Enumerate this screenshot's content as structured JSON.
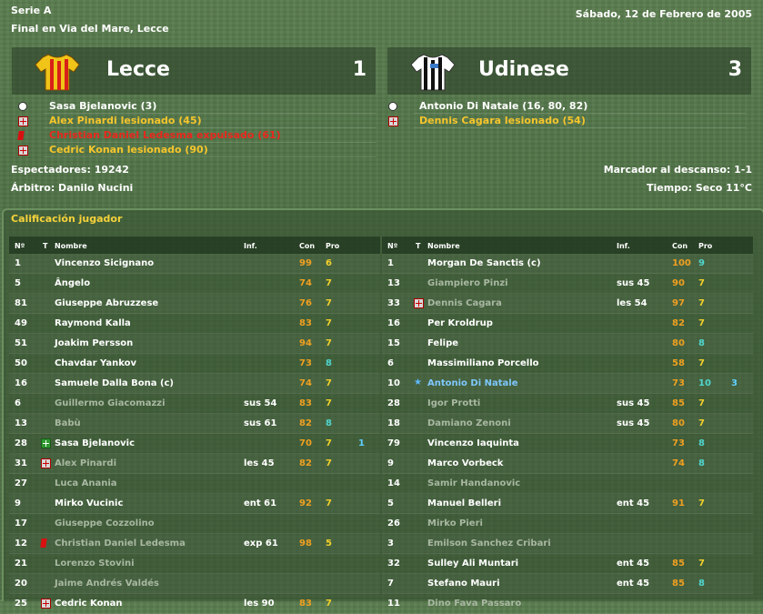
{
  "header": {
    "competition": "Serie A",
    "status": "Final en Via del Mare, Lecce",
    "date": "Sábado, 12 de Febrero de 2005"
  },
  "home": {
    "name": "Lecce",
    "score": "1",
    "shirt_colors": [
      "#f0c418",
      "#d82018"
    ],
    "events": [
      {
        "icon": "ball",
        "text": "Sasa Bjelanovic (3)",
        "color": "#ffffff"
      },
      {
        "icon": "injury",
        "text": "Alex Pinardi lesionado (45)",
        "color": "#f6c52c"
      },
      {
        "icon": "red-card",
        "text": "Christian Daniel Ledesma expulsado (61)",
        "color": "#e8281c"
      },
      {
        "icon": "injury",
        "text": "Cedric Konan lesionado (90)",
        "color": "#f6c52c"
      }
    ]
  },
  "away": {
    "name": "Udinese",
    "score": "3",
    "shirt_colors": [
      "#ffffff",
      "#111111"
    ],
    "events": [
      {
        "icon": "ball",
        "text": "Antonio Di Natale (16, 80, 82)",
        "color": "#ffffff"
      },
      {
        "icon": "injury",
        "text": "Dennis Cagara lesionado (54)",
        "color": "#f6c52c"
      }
    ]
  },
  "info": {
    "spectators": "Espectadores: 19242",
    "referee": "Árbitro: Danilo Nucini",
    "halftime": "Marcador al descanso: 1-1",
    "weather": "Tiempo: Seco 11°C"
  },
  "ratings": {
    "title": "Calificación jugador",
    "columns": {
      "num": "Nº",
      "t": "T",
      "name": "Nombre",
      "inf": "Inf.",
      "con": "Con",
      "pro": "Pro"
    },
    "home_players": [
      {
        "num": "1",
        "icon": "",
        "name": "Vincenzo Sicignano",
        "inf": "",
        "con": "99",
        "pro": "6",
        "goals": "",
        "dim": false,
        "hi": false
      },
      {
        "num": "5",
        "icon": "",
        "name": "Ângelo",
        "inf": "",
        "con": "74",
        "pro": "7",
        "goals": "",
        "dim": false,
        "hi": false
      },
      {
        "num": "81",
        "icon": "",
        "name": "Giuseppe Abruzzese",
        "inf": "",
        "con": "76",
        "pro": "7",
        "goals": "",
        "dim": false,
        "hi": false
      },
      {
        "num": "49",
        "icon": "",
        "name": "Raymond Kalla",
        "inf": "",
        "con": "83",
        "pro": "7",
        "goals": "",
        "dim": false,
        "hi": false
      },
      {
        "num": "51",
        "icon": "",
        "name": "Joakim Persson",
        "inf": "",
        "con": "94",
        "pro": "7",
        "goals": "",
        "dim": false,
        "hi": false
      },
      {
        "num": "50",
        "icon": "",
        "name": "Chavdar Yankov",
        "inf": "",
        "con": "73",
        "pro": "8",
        "goals": "",
        "dim": false,
        "hi": true
      },
      {
        "num": "16",
        "icon": "",
        "name": "Samuele Dalla Bona (c)",
        "inf": "",
        "con": "74",
        "pro": "7",
        "goals": "",
        "dim": false,
        "hi": false
      },
      {
        "num": "6",
        "icon": "",
        "name": "Guillermo Giacomazzi",
        "inf": "sus 54",
        "con": "83",
        "pro": "7",
        "goals": "",
        "dim": true,
        "hi": false
      },
      {
        "num": "13",
        "icon": "",
        "name": "Babù",
        "inf": "sus 61",
        "con": "82",
        "pro": "8",
        "goals": "",
        "dim": true,
        "hi": true
      },
      {
        "num": "28",
        "icon": "sub",
        "name": "Sasa Bjelanovic",
        "inf": "",
        "con": "70",
        "pro": "7",
        "goals": "1",
        "dim": false,
        "hi": false
      },
      {
        "num": "31",
        "icon": "injury",
        "name": "Alex Pinardi",
        "inf": "les 45",
        "con": "82",
        "pro": "7",
        "goals": "",
        "dim": true,
        "hi": false
      },
      {
        "num": "27",
        "icon": "",
        "name": "Luca Anania",
        "inf": "",
        "con": "",
        "pro": "",
        "goals": "",
        "dim": true,
        "hi": false
      },
      {
        "num": "9",
        "icon": "",
        "name": "Mirko Vucinic",
        "inf": "ent 61",
        "con": "92",
        "pro": "7",
        "goals": "",
        "dim": false,
        "hi": false
      },
      {
        "num": "17",
        "icon": "",
        "name": "Giuseppe Cozzolino",
        "inf": "",
        "con": "",
        "pro": "",
        "goals": "",
        "dim": true,
        "hi": false
      },
      {
        "num": "12",
        "icon": "red-card",
        "name": "Christian Daniel Ledesma",
        "inf": "exp 61",
        "con": "98",
        "pro": "5",
        "goals": "",
        "dim": true,
        "hi": false
      },
      {
        "num": "21",
        "icon": "",
        "name": "Lorenzo Stovini",
        "inf": "",
        "con": "",
        "pro": "",
        "goals": "",
        "dim": true,
        "hi": false
      },
      {
        "num": "20",
        "icon": "",
        "name": "Jaime Andrés Valdés",
        "inf": "",
        "con": "",
        "pro": "",
        "goals": "",
        "dim": true,
        "hi": false
      },
      {
        "num": "25",
        "icon": "injury",
        "name": "Cedric Konan",
        "inf": "les 90",
        "con": "83",
        "pro": "7",
        "goals": "",
        "dim": false,
        "hi": false
      }
    ],
    "away_players": [
      {
        "num": "1",
        "icon": "",
        "name": "Morgan De Sanctis (c)",
        "inf": "",
        "con": "100",
        "pro": "9",
        "goals": "",
        "dim": false,
        "hi": true
      },
      {
        "num": "13",
        "icon": "",
        "name": "Giampiero Pinzi",
        "inf": "sus 45",
        "con": "90",
        "pro": "7",
        "goals": "",
        "dim": true,
        "hi": false
      },
      {
        "num": "33",
        "icon": "injury",
        "name": "Dennis Cagara",
        "inf": "les 54",
        "con": "97",
        "pro": "7",
        "goals": "",
        "dim": true,
        "hi": false
      },
      {
        "num": "16",
        "icon": "",
        "name": "Per Kroldrup",
        "inf": "",
        "con": "82",
        "pro": "7",
        "goals": "",
        "dim": false,
        "hi": false
      },
      {
        "num": "15",
        "icon": "",
        "name": "Felipe",
        "inf": "",
        "con": "80",
        "pro": "8",
        "goals": "",
        "dim": false,
        "hi": true
      },
      {
        "num": "6",
        "icon": "",
        "name": "Massimiliano Porcello",
        "inf": "",
        "con": "58",
        "pro": "7",
        "goals": "",
        "dim": false,
        "hi": false
      },
      {
        "num": "10",
        "icon": "star",
        "name": "Antonio Di Natale",
        "inf": "",
        "con": "73",
        "pro": "10",
        "goals": "3",
        "dim": false,
        "hi": true,
        "star": true
      },
      {
        "num": "28",
        "icon": "",
        "name": "Igor Protti",
        "inf": "sus 45",
        "con": "85",
        "pro": "7",
        "goals": "",
        "dim": true,
        "hi": false
      },
      {
        "num": "18",
        "icon": "",
        "name": "Damiano Zenoni",
        "inf": "sus 45",
        "con": "80",
        "pro": "7",
        "goals": "",
        "dim": true,
        "hi": false
      },
      {
        "num": "79",
        "icon": "",
        "name": "Vincenzo Iaquinta",
        "inf": "",
        "con": "73",
        "pro": "8",
        "goals": "",
        "dim": false,
        "hi": true
      },
      {
        "num": "9",
        "icon": "",
        "name": "Marco Vorbeck",
        "inf": "",
        "con": "74",
        "pro": "8",
        "goals": "",
        "dim": false,
        "hi": true
      },
      {
        "num": "14",
        "icon": "",
        "name": "Samir Handanovic",
        "inf": "",
        "con": "",
        "pro": "",
        "goals": "",
        "dim": true,
        "hi": false
      },
      {
        "num": "5",
        "icon": "",
        "name": "Manuel Belleri",
        "inf": "ent 45",
        "con": "91",
        "pro": "7",
        "goals": "",
        "dim": false,
        "hi": false
      },
      {
        "num": "26",
        "icon": "",
        "name": "Mirko Pieri",
        "inf": "",
        "con": "",
        "pro": "",
        "goals": "",
        "dim": true,
        "hi": false
      },
      {
        "num": "3",
        "icon": "",
        "name": "Emilson Sanchez Cribari",
        "inf": "",
        "con": "",
        "pro": "",
        "goals": "",
        "dim": true,
        "hi": false
      },
      {
        "num": "32",
        "icon": "",
        "name": "Sulley Ali Muntari",
        "inf": "ent 45",
        "con": "85",
        "pro": "7",
        "goals": "",
        "dim": false,
        "hi": false
      },
      {
        "num": "7",
        "icon": "",
        "name": "Stefano Mauri",
        "inf": "ent 45",
        "con": "85",
        "pro": "8",
        "goals": "",
        "dim": false,
        "hi": true
      },
      {
        "num": "11",
        "icon": "",
        "name": "Dino Fava Passaro",
        "inf": "",
        "con": "",
        "pro": "",
        "goals": "",
        "dim": true,
        "hi": false
      }
    ]
  }
}
